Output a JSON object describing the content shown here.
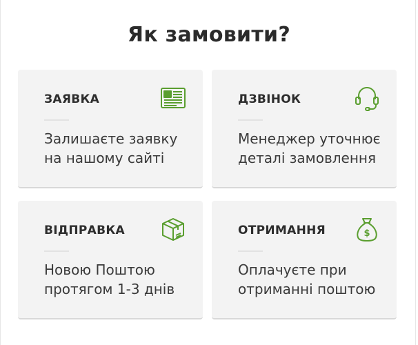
{
  "section": {
    "title": "Як замовити?"
  },
  "steps": [
    {
      "title": "ЗАЯВКА",
      "text": "Залишаєте заявку на нашому сайті",
      "icon": "form-document-icon"
    },
    {
      "title": "ДЗВІНОК",
      "text": "Менеджер уточнює деталі замовлення",
      "icon": "headset-icon"
    },
    {
      "title": "ВІДПРАВКА",
      "text": "Новою Поштою протягом 1-3 днів",
      "icon": "package-box-icon"
    },
    {
      "title": "ОТРИМАННЯ",
      "text": "Оплачуєте при отриманні поштою",
      "icon": "money-bag-icon"
    }
  ],
  "colors": {
    "accent": "#5a9e2f",
    "card_bg": "#f3f3f3",
    "title": "#2b2b2b"
  }
}
